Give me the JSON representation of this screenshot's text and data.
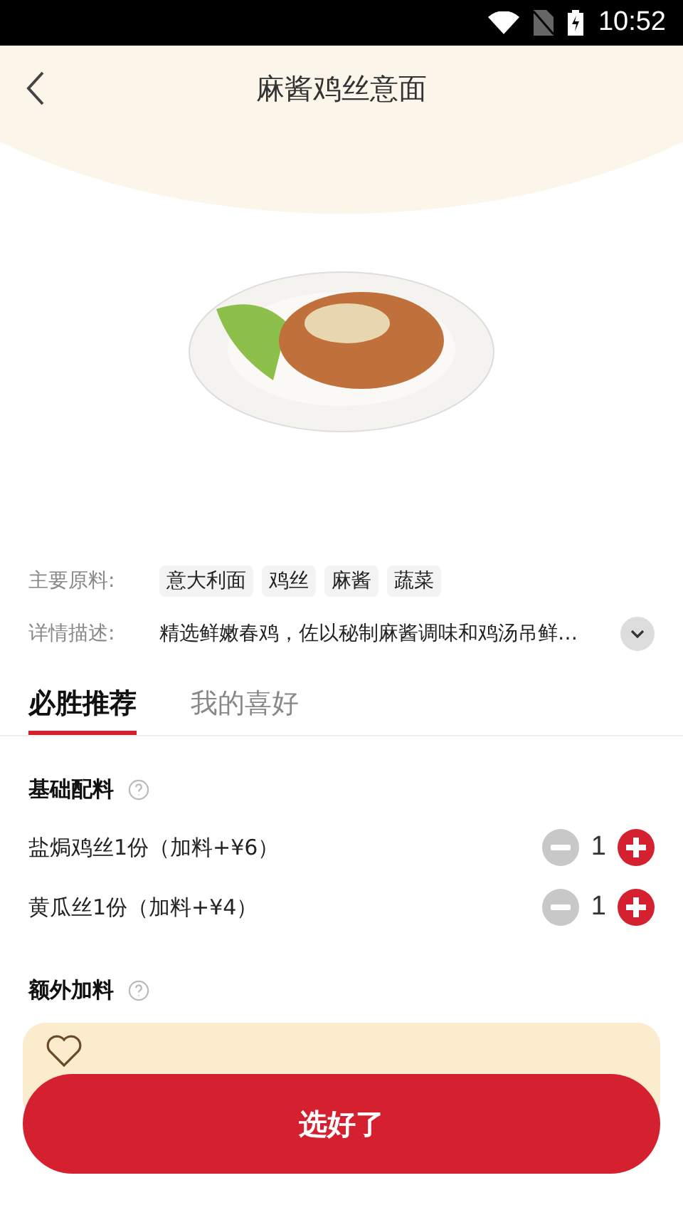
{
  "status_bar": {
    "time": "10:52"
  },
  "header": {
    "title": "麻酱鸡丝意面"
  },
  "ingredients": {
    "label": "主要原料:",
    "tags": [
      "意大利面",
      "鸡丝",
      "麻酱",
      "蔬菜"
    ]
  },
  "description": {
    "label": "详情描述:",
    "text": "精选鲜嫩春鸡，佐以秘制麻酱调味和鸡汤吊鲜…",
    "expanded": false
  },
  "tabs": [
    {
      "label": "必胜推荐",
      "selected": true
    },
    {
      "label": "我的喜好",
      "selected": false
    }
  ],
  "sections": [
    {
      "title": "基础配料",
      "items": [
        {
          "name": "盐焗鸡丝1份（加料+¥6）",
          "quantity": "1",
          "minus_disabled": true
        },
        {
          "name": "黄瓜丝1份（加料+¥4）",
          "quantity": "1",
          "minus_disabled": true
        }
      ]
    },
    {
      "title": "额外加料"
    }
  ],
  "footer": {
    "favorite": false,
    "button": "选好了"
  }
}
